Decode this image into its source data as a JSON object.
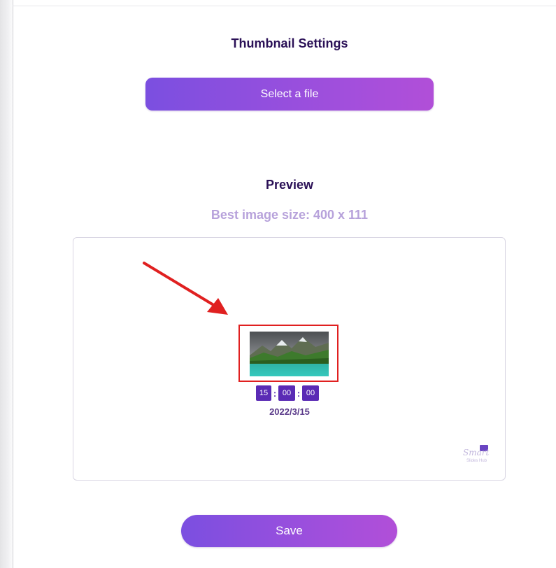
{
  "page": {
    "title": "Thumbnail Settings",
    "select_file_label": "Select a file",
    "preview_title": "Preview",
    "size_hint": "Best image size: 400 x 111",
    "save_label": "Save"
  },
  "preview": {
    "time": {
      "hours": "15",
      "separator": ":",
      "minutes": "00",
      "seconds": "00"
    },
    "date": "2022/3/15",
    "thumbnail_icon": "mountain-lake-image",
    "annotation_icon": "red-arrow"
  },
  "logo": {
    "text": "Smart",
    "subtext": "Slides Hub"
  },
  "colors": {
    "accent_start": "#7b4fe0",
    "accent_end": "#b14fd8",
    "heading": "#2b1157",
    "hint": "#b7a2db",
    "time_box": "#5a2bb5",
    "highlight": "#e02020"
  }
}
